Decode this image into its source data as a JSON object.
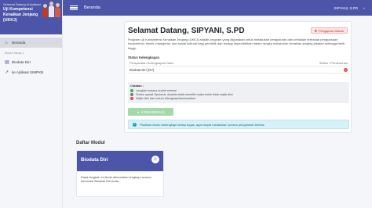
{
  "sidebar": {
    "banner_small": "Selamat Datang di Aplikasi",
    "banner_title": "Uji Kompetensi Kenaikan Jenjang (UKKJ)",
    "items": [
      {
        "label": "Beranda",
        "icon": "home-icon"
      }
    ],
    "section_label": "Modul Tahap 1",
    "section_items": [
      {
        "label": "Biodata Diri",
        "icon": "id-card-icon"
      },
      {
        "label": "ke Aplikasi SIMPKB",
        "icon": "link-icon"
      }
    ]
  },
  "header": {
    "breadcrumb": "Beranda",
    "user_name": "SIPYANI, S.PD"
  },
  "welcome": {
    "title": "Selamat Datang, SIPYANI, S.PD",
    "request_button": "Pengajuan Masuk",
    "intro": "Program Uji Kompetensi Kenaikan Jenjang (UKKJ) adalah program yang digunakan untuk melakukan pengukuran dan penilaian terhadap penguasaan kompetensi, teknis, manajerial, dan sosial kultural bagi pendidik dan tenaga kependidikan dalam rangka melakukan kenaikan jenjang jabatan sehingga lebih tinggi.",
    "status_title": "Status Kelengkapan",
    "table_headers": [
      "Persyaratan Kelengkapan Data",
      "Status / Pemenuhan"
    ],
    "table_rows": [
      {
        "item": "Biodata Diri (DV)",
        "status_icon": "x-circle-icon"
      }
    ],
    "notes_title": "Catatan :",
    "notes": [
      {
        "text": "Langkah sukses sudah selesai",
        "color": "#28a745"
      },
      {
        "text": "Status syarat Opsional, Apabila tidak memiliki maka boleh tidak wajib diisi",
        "color": "#6c757d"
      },
      {
        "text": "Wajib diisi dan belum dilengkapi/diselesaikan",
        "color": "#dc3545"
      }
    ],
    "send_button": "KIRIM BERKAS",
    "info_text": "Pastikan Anda melengkapi setiap tugas, agar dapat melakukan proses pengiriman berkas"
  },
  "modules": {
    "title": "Daftar Modul",
    "items": [
      {
        "name": "Biodata Diri",
        "description": "Pada langkah ini Anda diharuskan lengkapi semua informasi Biodata Diri Anda"
      }
    ]
  },
  "colors": {
    "primary": "#4c55a8",
    "success": "#28a745",
    "danger": "#dc3545",
    "info": "#17a2b8"
  }
}
